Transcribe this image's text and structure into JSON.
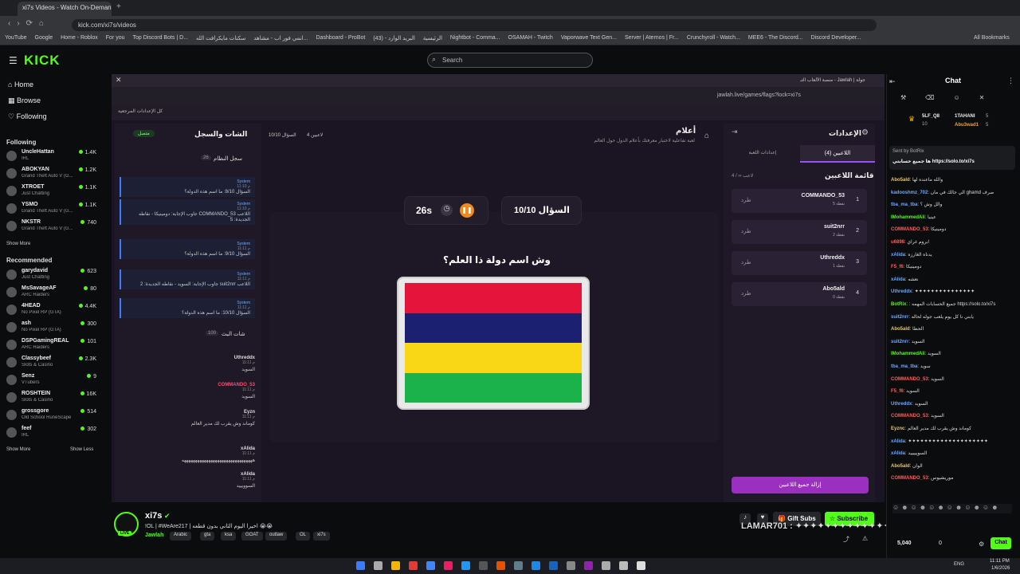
{
  "browser": {
    "tab_title": "xi7s Videos - Watch On-Deman",
    "url": "kick.com/xi7s/videos",
    "bookmarks": [
      "YouTube",
      "Google",
      "Home - Roblox",
      "For you",
      "Top Discord Bots | D...",
      "سكنات مايكرافت الله",
      "انمي فور اب - مشاهد...",
      "Dashboard - ProBot",
      "(43) - البريد الوارد",
      "الرئيسية",
      "Nightbot - Comma...",
      "OSAMAH - Twitch",
      "Vaporwave Text Gen...",
      "Server | Aternos | Fr...",
      "Crunchyroll - Watch...",
      "MEE6 - The Discord...",
      "Discord Developer..."
    ],
    "all_bookmarks": "All Bookmarks"
  },
  "kick": {
    "logo": "KICK",
    "search_placeholder": "Search"
  },
  "sidebar": {
    "nav": [
      "Home",
      "Browse",
      "Following"
    ],
    "following_title": "Following",
    "following": [
      {
        "name": "UncleHattan",
        "game": "IRL",
        "viewers": "1.4K"
      },
      {
        "name": "ABOKYAN",
        "game": "Grand Theft Auto V (G...",
        "viewers": "1.2K"
      },
      {
        "name": "XTROET",
        "game": "Just Chatting",
        "viewers": "1.1K"
      },
      {
        "name": "YSMO",
        "game": "Grand Theft Auto V (G...",
        "viewers": "1.1K"
      },
      {
        "name": "NKSTR",
        "game": "Grand Theft Auto V (G...",
        "viewers": "740"
      }
    ],
    "show_more": "Show More",
    "recommended_title": "Recommended",
    "recommended": [
      {
        "name": "garydavid",
        "game": "Just Chatting",
        "viewers": "623"
      },
      {
        "name": "MsSavageAF",
        "game": "ARC Raiders",
        "viewers": "80"
      },
      {
        "name": "4HEAD",
        "game": "No Pixel RP (GTA)",
        "viewers": "4.4K"
      },
      {
        "name": "ash",
        "game": "No Pixel RP (GTA)",
        "viewers": "300"
      },
      {
        "name": "DSPGamingREAL",
        "game": "ARC Raiders",
        "viewers": "101"
      },
      {
        "name": "Classybeef",
        "game": "Slots & Casino",
        "viewers": "2.3K"
      },
      {
        "name": "Senz",
        "game": "VTubers",
        "viewers": "9"
      },
      {
        "name": "ROSHTEIN",
        "game": "Slots & Casino",
        "viewers": "16K"
      },
      {
        "name": "grossgore",
        "game": "Old School RuneScape",
        "viewers": "514"
      },
      {
        "name": "feef",
        "game": "IRL",
        "viewers": "302"
      }
    ],
    "show_more2": "Show More",
    "show_less": "Show Less"
  },
  "game": {
    "inner_url": "jawlah.live/games/flags?lock=xi7s",
    "inner_tab": "جولة | Jawlah - منصة الألعاب التـ",
    "all_settings": "كل الإعدادات المرجعية",
    "left_title": "الشات والسجل",
    "connected": "متصل",
    "system_log_title": "سجل النظام",
    "system_log_count": "26",
    "system_logs": [
      {
        "time": "11:10 م",
        "sender": "System",
        "text": "السؤال 8/10: ما اسم هذه الدولة؟"
      },
      {
        "time": "11:10 م",
        "sender": "System",
        "text": "اللاعب COMMANDO_53 جاوب الإجابة: دومينيكا - نقاطه الجديدة: 5"
      },
      {
        "time": "11:11 م",
        "sender": "System",
        "text": "السؤال 9/10: ما اسم هذه الدولة؟"
      },
      {
        "time": "11:11 م",
        "sender": "System",
        "text": "اللاعب suit2nrr جاوب الإجابة: السويد - نقاطه الجديدة: 2"
      },
      {
        "time": "11:11 م",
        "sender": "System",
        "text": "السؤال 10/10: ما اسم هذه الدولة؟"
      }
    ],
    "stream_chat_title": "شات البث",
    "stream_chat_count": "100",
    "stream_chat": [
      {
        "time": "11:11 م",
        "user": "Uthreddx",
        "text": "السويد"
      },
      {
        "time": "11:11 م",
        "user": "COMMANDO_53",
        "text": "السويد"
      },
      {
        "time": "11:11 م",
        "user": "Eyzn",
        "text": "كوماند وش يقرب لك مدير العالم"
      },
      {
        "time": "11:11 م",
        "user": "xAlida",
        "text": "ههههههههههههههههههههههههههههههههه"
      },
      {
        "time": "11:11 م",
        "user": "xAlida",
        "text": "السوويييد"
      }
    ],
    "game_title": "أعلام",
    "game_subtitle": "لعبة تفاعلية لاختبار معرفتك بأعلام الدول حول العالم",
    "players_count": "4 لاعبين",
    "question_counter": "السؤال 10/10",
    "timer": "26s",
    "question_box": "السؤال 10/10",
    "question": "وش اسم دولة ذا العلم؟",
    "settings_title": "الإعدادات",
    "tab_players": "اللاعبين (4)",
    "tab_game_settings": "إعدادات اللعبة",
    "players_list_title": "قائمة اللاعبين",
    "players_list_count": "4 / ∞ لاعب",
    "players": [
      {
        "rank": "1",
        "name": "COMMANDO_53",
        "score": "5 نقطة",
        "kick": "طرد"
      },
      {
        "rank": "2",
        "name": "suit2nrr",
        "score": "2 نقطة",
        "kick": "طرد"
      },
      {
        "rank": "3",
        "name": "Uthreddx",
        "score": "1 نقطة",
        "kick": "طرد"
      },
      {
        "rank": "4",
        "name": "Abo5ald",
        "score": "0 نقطة",
        "kick": "طرد"
      }
    ],
    "remove_all": "إزالة جميع اللاعبين",
    "flag_colors": [
      "#e5143a",
      "#1b2170",
      "#f9d616",
      "#1cb24b"
    ]
  },
  "stream_info": {
    "channel": "xi7s",
    "title": "!OL | #WeAre217 | اخيرا اليوم الثاني بدون قطعه 😭😭",
    "category": "Jawlah",
    "tags": [
      "Arabic",
      "gta",
      "ksa",
      "GOAT",
      "outlaw",
      "OL",
      "xi7s"
    ],
    "gift_subs": "Gift Subs",
    "subscribe": "Subscribe",
    "overlay_text": "LAMAR701 : ✦✦✦✦✦✦✦✦✦✦✦✦✦✦✦✦✦✦✦✦✦✦✦✦✦✦✦✦✦✦✦✦"
  },
  "chat": {
    "title": "Chat",
    "top_gifters": [
      {
        "name": "1TAHANI",
        "count": "5"
      },
      {
        "name": "Abu3wad1",
        "count": "5"
      }
    ],
    "top_left_user": "5LF_Q8",
    "top_left_count": "10",
    "pinned_by": "Sent by BotRix",
    "pinned_text": "ها جميع حسابتي https://solo.to/xi7s",
    "messages": [
      {
        "user": "Abo5ald",
        "color": "#e9c46a",
        "text": "والله ماعنده لها"
      },
      {
        "user": "kadooshmz_702",
        "color": "#6ea8fe",
        "text": "الي جالك في مان ghamd صرف"
      },
      {
        "user": "tba_ma_tba",
        "color": "#6ea8fe",
        "text": "وآلل وش ؟"
      },
      {
        "user": "IMohammedAli",
        "color": "#53fc18",
        "text": "عينيا"
      },
      {
        "user": "COMMANDO_53",
        "color": "#ff5c5c",
        "text": "دومينيكا"
      },
      {
        "user": "u6898",
        "color": "#ff5c5c",
        "text": "ابروم غراي"
      },
      {
        "user": "xAlida",
        "color": "#6ea8fe",
        "text": "يدناه الغارزه"
      },
      {
        "user": "F5_f6",
        "color": "#ff5c5c",
        "text": "دومينيكا"
      },
      {
        "user": "xAlida",
        "color": "#6ea8fe",
        "text": "نعشه"
      },
      {
        "user": "Uthreddx",
        "color": "#6ea8fe",
        "text": "✦✦✦✦✦✦✦✦✦✦✦✦✦✦✦"
      },
      {
        "user": "BotRix",
        "color": "#53fc18",
        "text": ": جميع الحسابات المهمه https://solo.to/xi7s"
      },
      {
        "user": "suit2nrr",
        "color": "#6ea8fe",
        "text": "يابني نا كل يوم يلعب جوله لحاله"
      },
      {
        "user": "Abo5ald",
        "color": "#e9c46a",
        "text": "الحظا"
      },
      {
        "user": "suit2nrr",
        "color": "#6ea8fe",
        "text": "السويد"
      },
      {
        "user": "IMohammedAli",
        "color": "#53fc18",
        "text": "السويد"
      },
      {
        "user": "tba_ma_tba",
        "color": "#6ea8fe",
        "text": "سويد"
      },
      {
        "user": "COMMANDO_53",
        "color": "#ff5c5c",
        "text": "السويد"
      },
      {
        "user": "F5_f6",
        "color": "#ff5c5c",
        "text": "السويد"
      },
      {
        "user": "Uthreddx",
        "color": "#6ea8fe",
        "text": "السويد"
      },
      {
        "user": "COMMANDO_53",
        "color": "#ff5c5c",
        "text": "السويد"
      },
      {
        "user": "Eyznc",
        "color": "#e9c46a",
        "text": "كوماند وش يقرب لك مدير العالم"
      },
      {
        "user": "xAlida",
        "color": "#6ea8fe",
        "text": "✦✦✦✦✦✦✦✦✦✦✦✦✦✦✦✦✦✦✦✦"
      },
      {
        "user": "xAlida",
        "color": "#6ea8fe",
        "text": "السويييييد"
      },
      {
        "user": "Abo5ald",
        "color": "#e9c46a",
        "text": "الوان"
      },
      {
        "user": "COMMANDO_53",
        "color": "#ff5c5c",
        "text": "موريشيوس"
      }
    ],
    "balance": "5,040",
    "count2": "0",
    "chat_button": "Chat"
  },
  "taskbar": {
    "lang": "ENG",
    "time": "11:11 PM",
    "date": "1/6/2026"
  }
}
